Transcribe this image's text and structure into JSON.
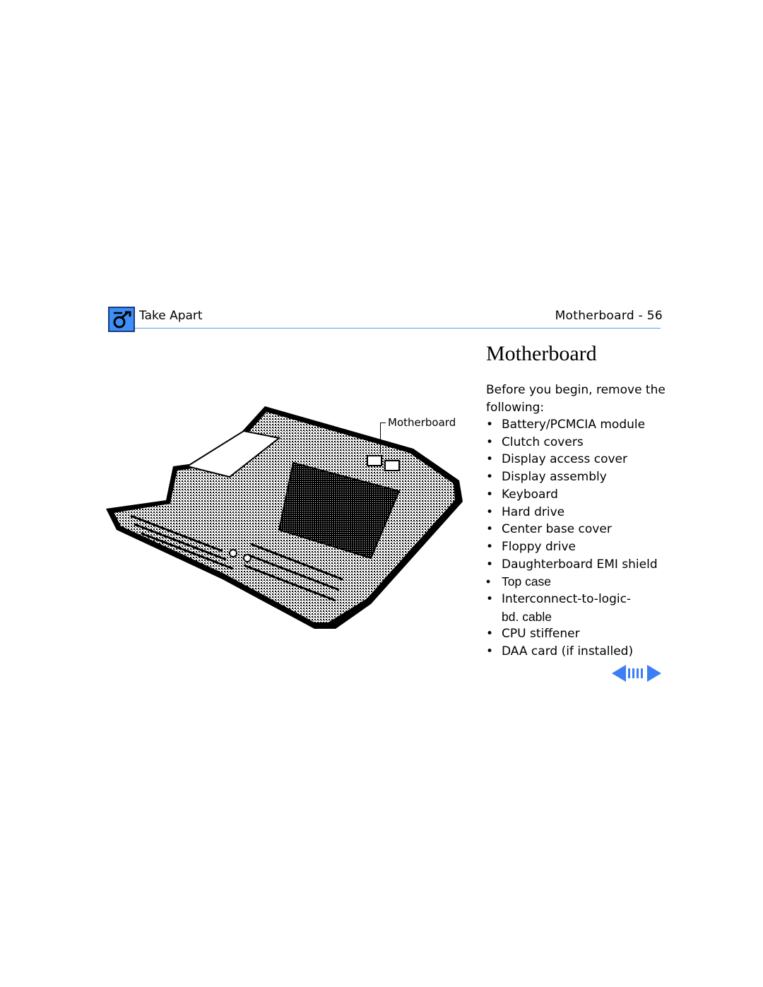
{
  "header": {
    "section": "Take Apart",
    "page_label": "Motherboard -  56",
    "accent_color": "#3d8ef5",
    "icon": "apple-wrench-icon"
  },
  "title": "Motherboard",
  "intro": "Before you begin, remove the following:",
  "items": [
    "Battery/PCMCIA module",
    "Clutch covers",
    "Display access cover",
    "Display assembly",
    "Keyboard",
    "Hard drive",
    "Center base cover",
    "Floppy drive",
    "Daughterboard EMI shield",
    "Top case",
    "Interconnect-to-logic-",
    "bd. cable",
    "CPU stiffener",
    "DAA card (if installed)"
  ],
  "bullet": "•",
  "figure": {
    "callout": "Motherboard",
    "alt": "Line illustration of the motherboard seated in the bottom case"
  },
  "nav": {
    "prev": "previous-page",
    "index": "page-index",
    "next": "next-page",
    "color": "#3d7ef5"
  }
}
